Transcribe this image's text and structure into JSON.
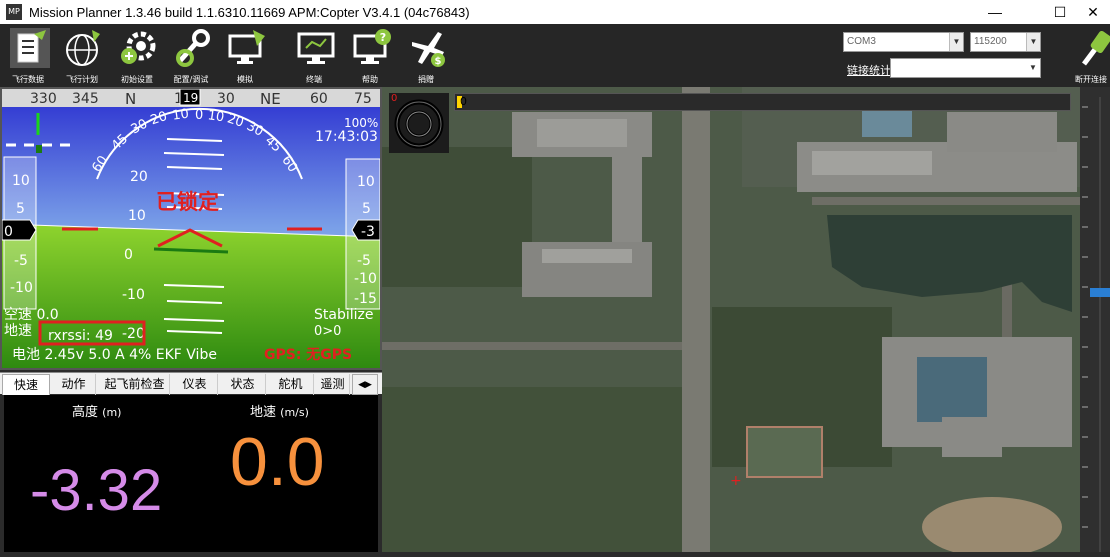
{
  "window": {
    "title": "Mission Planner 1.3.46 build 1.1.6310.11669 APM:Copter V3.4.1 (04c76843)",
    "logo_text": "MP",
    "minimize": "—",
    "maximize": "☐",
    "close": "✕"
  },
  "toolbar": {
    "buttons": [
      {
        "label": "飞行数据",
        "icon": "flight-data-icon"
      },
      {
        "label": "飞行计划",
        "icon": "flight-plan-icon"
      },
      {
        "label": "初始设置",
        "icon": "initial-setup-icon"
      },
      {
        "label": "配置/调试",
        "icon": "config-tuning-icon"
      },
      {
        "label": "模拟",
        "icon": "simulation-icon"
      },
      {
        "label": "终端",
        "icon": "terminal-icon"
      },
      {
        "label": "帮助",
        "icon": "help-icon"
      },
      {
        "label": "捐赠",
        "icon": "donate-icon"
      },
      {
        "label": "断开连接",
        "icon": "disconnect-icon"
      }
    ],
    "port_value": "COM3",
    "baud_value": "115200",
    "link_stats_label": "链接统计",
    "link_select_value": ""
  },
  "hud": {
    "heading_ticks": [
      "330",
      "345",
      "N",
      "15",
      "30",
      "NE",
      "60",
      "75"
    ],
    "heading_value": "19",
    "roll_scale": [
      "60",
      "45",
      "30",
      "20",
      "10",
      "0",
      "10",
      "20",
      "30",
      "45",
      "60"
    ],
    "pitch_labels": [
      "20",
      "10",
      "0",
      "-10",
      "-20"
    ],
    "armed_text": "已锁定",
    "left_tape_labels": [
      "10",
      "5",
      "-5",
      "-10"
    ],
    "left_tape_value": "0",
    "right_tape_labels": [
      "10",
      "5",
      "-5",
      "-10",
      "-15"
    ],
    "right_tape_value": "-3",
    "battery_remaining": "100%",
    "time": "17:43:03",
    "airspeed": "空速 0.0",
    "groundspeed": "地速",
    "rxrssi": "rxrssi: 49",
    "mode": "Stabilize",
    "wp": "0>0",
    "status_line": "电池 2.45v 5.0 A 4% EKF   Vibe",
    "gps_status": "GPS: 无GPS"
  },
  "tabs": [
    "快速",
    "动作",
    "起飞前检查",
    "仪表",
    "状态",
    "舵机",
    "遥测"
  ],
  "quick": {
    "altitude_label": "高度",
    "altitude_unit": "(m)",
    "altitude_value": "-3.32",
    "groundspeed_label": "地速",
    "groundspeed_unit": "(m/s)",
    "groundspeed_value": "0.0"
  },
  "map": {
    "corner_value": "0",
    "progress_value": "0",
    "colors": {
      "altitude": "#d58be8",
      "speed": "#f7913d",
      "accent": "#e02020"
    }
  }
}
